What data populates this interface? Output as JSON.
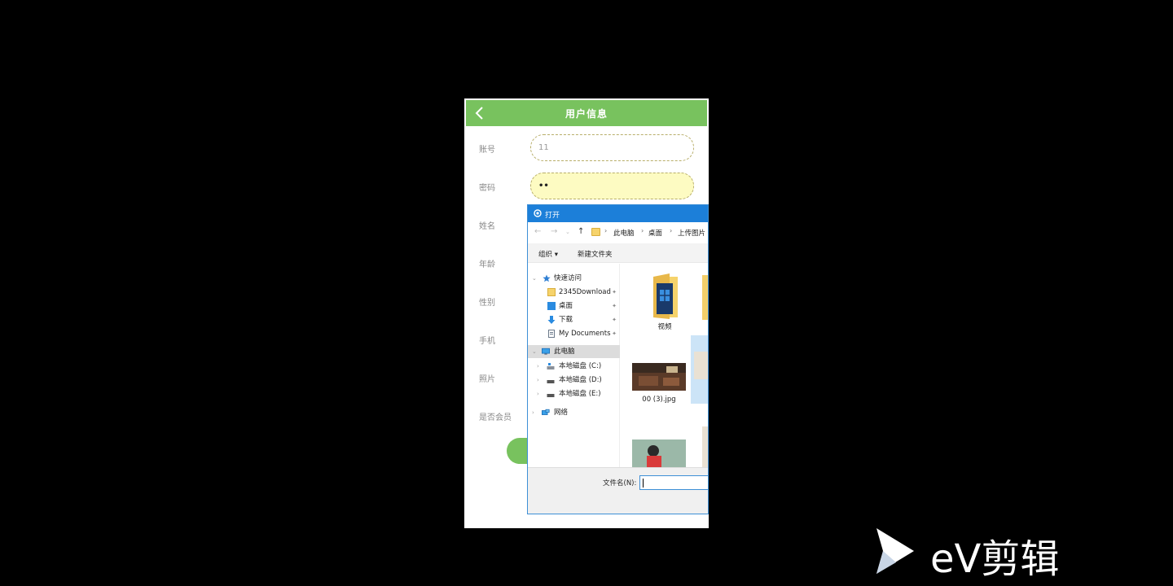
{
  "phone": {
    "title": "用户信息",
    "labels": {
      "account": "账号",
      "password": "密码",
      "name": "姓名",
      "age": "年龄",
      "gender": "性别",
      "phone": "手机",
      "photo": "照片",
      "member": "是否会员"
    },
    "account_value": "11",
    "password_value": "••"
  },
  "dialog": {
    "title": "打开",
    "breadcrumb": [
      "此电脑",
      "桌面",
      "上传图片"
    ],
    "toolbar": {
      "organize": "组织 ▾",
      "new_folder": "新建文件夹"
    },
    "nav": {
      "quick_access": "快速访问",
      "download_2345": "2345Download",
      "desktop": "桌面",
      "downloads": "下载",
      "my_documents": "My Documents",
      "this_pc": "此电脑",
      "drive_c": "本地磁盘 (C:)",
      "drive_d": "本地磁盘 (D:)",
      "drive_e": "本地磁盘 (E:)",
      "network": "网络"
    },
    "files": {
      "video_folder": "视频",
      "image1": "00 (3).jpg"
    },
    "filename_label": "文件名(N):",
    "filename_value": ""
  },
  "watermark": {
    "text": "eV剪辑"
  },
  "colors": {
    "header_green": "#78c25e",
    "dialog_blue": "#1c7fd9",
    "focused_field": "#fdfbc2"
  }
}
